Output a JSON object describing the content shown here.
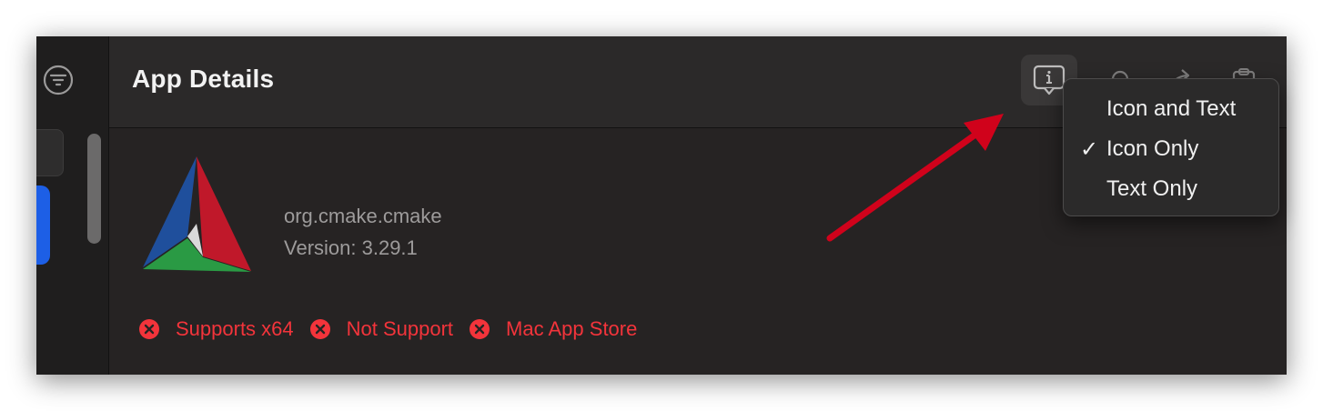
{
  "header": {
    "title": "App Details"
  },
  "toolbar": {
    "buttons": [
      {
        "icon": "info-bubble-icon",
        "active": true
      },
      {
        "icon": "bell-icon",
        "active": false
      },
      {
        "icon": "share-arrow-icon",
        "active": false
      },
      {
        "icon": "clipboard-icon",
        "active": false
      }
    ]
  },
  "app": {
    "icon": "cmake-logo",
    "bundle_id": "org.cmake.cmake",
    "version": "Version: 3.29.1"
  },
  "tags": [
    {
      "label": "Supports x64",
      "icon": "x-circle-icon",
      "color": "#f3343b"
    },
    {
      "label": "Not Support",
      "icon": "x-circle-icon",
      "color": "#f3343b"
    },
    {
      "label": "Mac App Store",
      "icon": "x-circle-icon",
      "color": "#f3343b"
    }
  ],
  "menu": {
    "items": [
      {
        "label": "Icon and Text",
        "checked": false,
        "check_mark": ""
      },
      {
        "label": "Icon Only",
        "checked": true,
        "check_mark": "✓"
      },
      {
        "label": "Text Only",
        "checked": false,
        "check_mark": ""
      }
    ]
  },
  "sidebar": {
    "filter_icon": "filter-icon"
  },
  "colors": {
    "accent_blue": "#1d5fe6",
    "error_red": "#f3343b",
    "annotation_arrow": "#d0021b"
  }
}
